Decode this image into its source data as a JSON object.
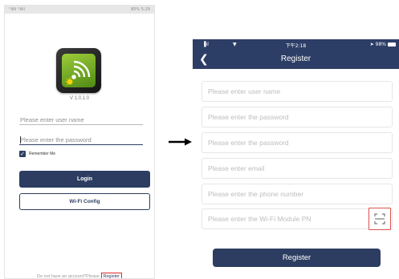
{
  "login": {
    "status_left": "°₴il °₴il",
    "status_right": "85% 5:29",
    "version": "V 1.0.1.0",
    "username_placeholder": "Please enter user name",
    "password_placeholder": "Please enter the password",
    "remember_label": "Remember Me",
    "login_label": "Login",
    "wifi_config_label": "Wi-Fi Config",
    "footer_question": "Do not have an account?Please",
    "footer_register": "Register"
  },
  "register": {
    "status": {
      "signal": "▐ıl",
      "wifi": "▼",
      "time": "下午2:18",
      "battery": "➤ 98%"
    },
    "back_icon": "chevron-left-icon",
    "title": "Register",
    "fields": {
      "username_placeholder": "Please enter user name",
      "password_placeholder": "Please enter the password",
      "confirm_password_placeholder": "Please enter the password",
      "email_placeholder": "Please enter email",
      "phone_placeholder": "Please enter the phone number",
      "wifi_module_placeholder": "Please enter the Wi-Fi Module PN"
    },
    "scan_icon": "qr-scan-icon",
    "register_label": "Register"
  },
  "colors": {
    "navy": "#2c3d61",
    "highlight_red": "#d92b2b",
    "logo_green": "#7bb32e"
  }
}
